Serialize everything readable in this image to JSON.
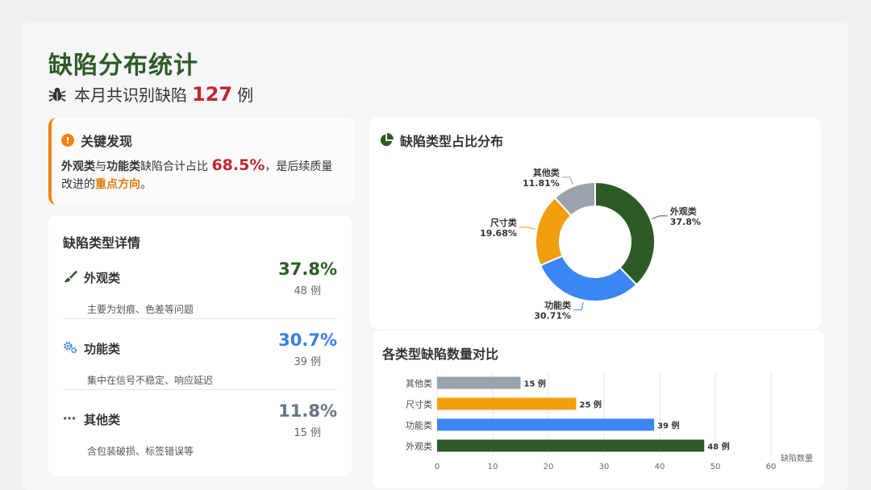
{
  "header": {
    "title": "缺陷分布统计",
    "subtitle_prefix": "本月共识别缺陷",
    "total": "127",
    "subtitle_suffix": "例"
  },
  "finding": {
    "heading": "关键发现",
    "cat1": "外观类",
    "conj": "与",
    "cat2": "功能类",
    "text1": "缺陷合计占比",
    "pct": "68.5%",
    "text2": "，是后续质量改进的",
    "focus": "重点方向",
    "end": "。"
  },
  "detail": {
    "title": "缺陷类型详情",
    "items": [
      {
        "name": "外观类",
        "pct": "37.8%",
        "count": "48 例",
        "desc": "主要为划痕、色差等问题",
        "color": "#2e5a27",
        "icon": "brush-icon"
      },
      {
        "name": "功能类",
        "pct": "30.7%",
        "count": "39 例",
        "desc": "集中在信号不稳定、响应延迟",
        "color": "#3b7de6",
        "icon": "gears-icon"
      },
      {
        "name": "其他类",
        "pct": "11.8%",
        "count": "15 例",
        "desc": "含包装破损、标签错误等",
        "color": "#6b7480",
        "icon": "ellipsis-icon"
      }
    ]
  },
  "pie": {
    "title": "缺陷类型占比分布"
  },
  "bar": {
    "title": "各类型缺陷数量对比"
  },
  "chart_data": [
    {
      "type": "pie",
      "variant": "donut",
      "title": "缺陷类型占比分布",
      "slices": [
        {
          "label": "外观类",
          "value": 37.8,
          "display": "37.8%",
          "color": "#2e5a27"
        },
        {
          "label": "功能类",
          "value": 30.71,
          "display": "30.71%",
          "color": "#3b86f2"
        },
        {
          "label": "尺寸类",
          "value": 19.68,
          "display": "19.68%",
          "color": "#f0a00f"
        },
        {
          "label": "其他类",
          "value": 11.81,
          "display": "11.81%",
          "color": "#9aa3ad"
        }
      ]
    },
    {
      "type": "bar",
      "orientation": "horizontal",
      "title": "各类型缺陷数量对比",
      "categories": [
        "其他类",
        "尺寸类",
        "功能类",
        "外观类"
      ],
      "values": [
        15,
        25,
        39,
        48
      ],
      "value_suffix": " 例",
      "colors": [
        "#9aa3ad",
        "#f0a00f",
        "#3b86f2",
        "#2e5a27"
      ],
      "xlabel": "缺陷数量",
      "xlim": [
        0,
        60
      ],
      "xticks": [
        0,
        10,
        20,
        30,
        40,
        50,
        60
      ],
      "grid": true
    }
  ]
}
